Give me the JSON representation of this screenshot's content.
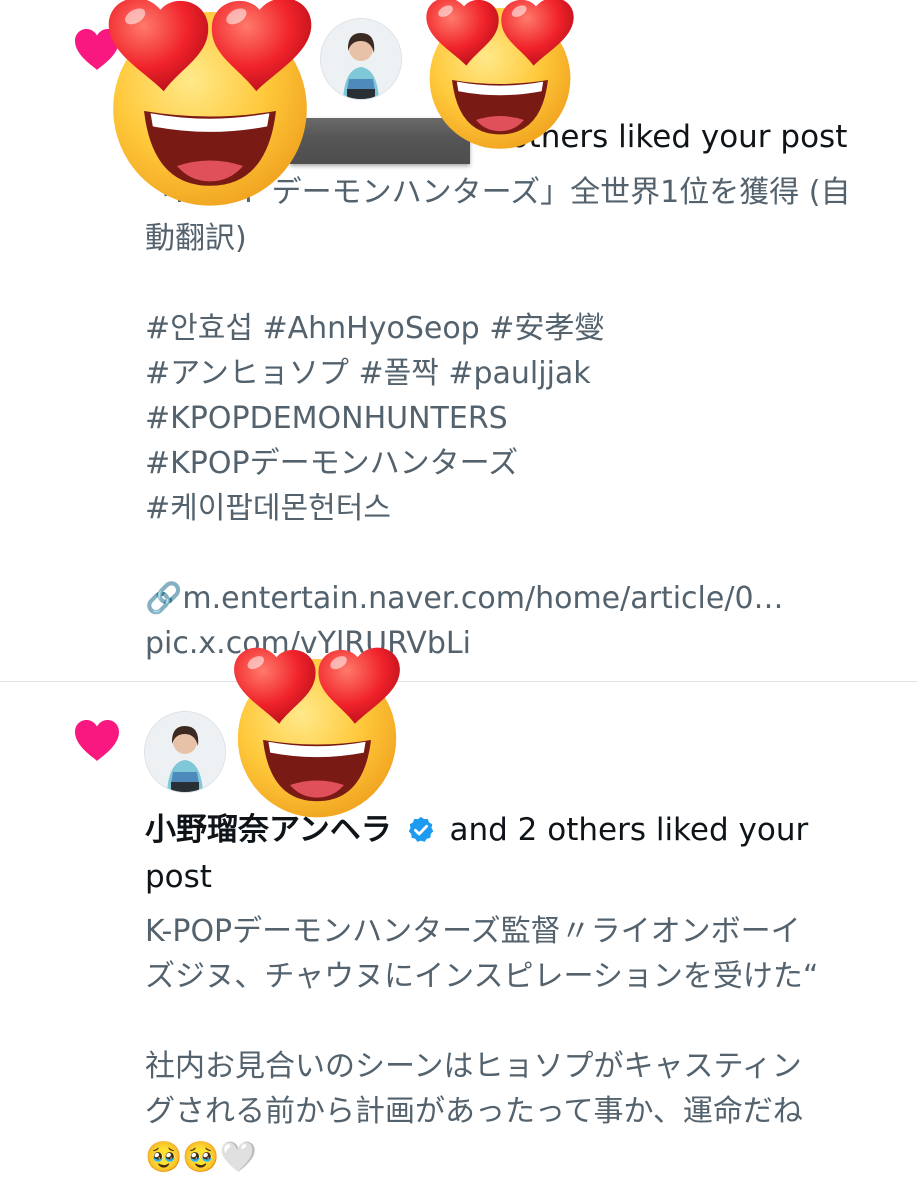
{
  "notifications": [
    {
      "heading_suffix": "3 others liked your post",
      "body_lines": [
        "「K-POP デーモンハンターズ」全世界1位を獲得 (自",
        "動翻訳)",
        "",
        "#안효섭 #AhnHyoSeop #安孝燮",
        "#アンヒョソプ #폴짝  #pauljjak",
        "#KPOPDEMONHUNTERS",
        "#KPOPデーモンハンターズ",
        "#케이팝데몬헌터스",
        "",
        "🔗m.entertain.naver.com/home/article/0…",
        "pic.x.com/vYlRURVbLi"
      ]
    },
    {
      "name": "小野瑠奈アンヘラ",
      "verified": true,
      "heading_suffix": "and 2 others liked your",
      "heading_suffix_2": "post",
      "body_lines": [
        "K-POPデーモンハンターズ監督〃ライオンボーイ",
        "ズジヌ、チャウヌにインスピレーションを受けた“",
        "",
        "社内お見合いのシーンはヒョソプがキャスティン",
        "グされる前から計画があったって事か、運命だね",
        "🥹🥹🤍"
      ]
    }
  ],
  "icons": {
    "like": "heart-icon",
    "verified": "verified-badge-icon",
    "sticker": "heart-eyes-emoji"
  },
  "colors": {
    "heart": "#f91880",
    "verified": "#1d9bf0",
    "text": "#0f1419",
    "secondary": "#53626d"
  }
}
